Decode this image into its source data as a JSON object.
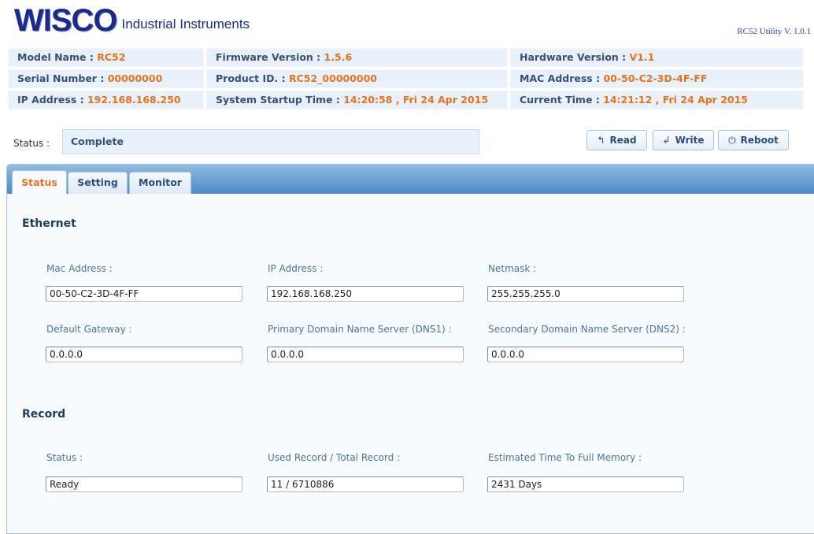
{
  "header": {
    "logo_text": "WISCO",
    "logo_subtitle": "Industrial Instruments",
    "version": "RC52 Utility V. 1.0.1"
  },
  "device_info": [
    [
      {
        "label": "Model Name :",
        "value": "RC52"
      },
      {
        "label": "Firmware Version :",
        "value": "1.5.6"
      },
      {
        "label": "Hardware Version :",
        "value": "V1.1"
      }
    ],
    [
      {
        "label": "Serial Number :",
        "value": "00000000"
      },
      {
        "label": "Product ID. :",
        "value": "RC52_00000000"
      },
      {
        "label": "MAC Address :",
        "value": "00-50-C2-3D-4F-FF"
      }
    ],
    [
      {
        "label": "IP Address :",
        "value": "192.168.168.250"
      },
      {
        "label": "System Startup Time :",
        "value": "14:20:58 , Fri 24 Apr 2015"
      },
      {
        "label": "Current Time :",
        "value": "14:21:12 , Fri 24 Apr 2015"
      }
    ]
  ],
  "status_bar": {
    "label": "Status :",
    "value": "Complete"
  },
  "toolbar": {
    "read_label": "Read",
    "write_label": "Write",
    "reboot_label": "Reboot"
  },
  "tabs": [
    {
      "label": "Status",
      "active": true
    },
    {
      "label": "Setting",
      "active": false
    },
    {
      "label": "Monitor",
      "active": false
    }
  ],
  "ethernet": {
    "title": "Ethernet",
    "fields": [
      {
        "label": "Mac Address :",
        "value": "00-50-C2-3D-4F-FF"
      },
      {
        "label": "IP Address :",
        "value": "192.168.168.250"
      },
      {
        "label": "Netmask :",
        "value": "255.255.255.0"
      },
      {
        "label": "Default Gateway :",
        "value": "0.0.0.0"
      },
      {
        "label": "Primary Domain Name Server (DNS1) :",
        "value": "0.0.0.0"
      },
      {
        "label": "Secondary Domain Name Server (DNS2) :",
        "value": "0.0.0.0"
      }
    ]
  },
  "record": {
    "title": "Record",
    "fields": [
      {
        "label": "Status :",
        "value": "Ready"
      },
      {
        "label": "Used Record / Total Record :",
        "value": "11 / 6710886"
      },
      {
        "label": "Estimated Time To Full Memory :",
        "value": "2431 Days"
      }
    ]
  },
  "colors": {
    "accent": "#e8731c",
    "label": "#3b4f73",
    "tabbar": "#4f8bc6",
    "logo": "#1c2a8c"
  },
  "icons": {
    "read": "read-icon",
    "write": "write-icon",
    "reboot": "power-icon"
  }
}
